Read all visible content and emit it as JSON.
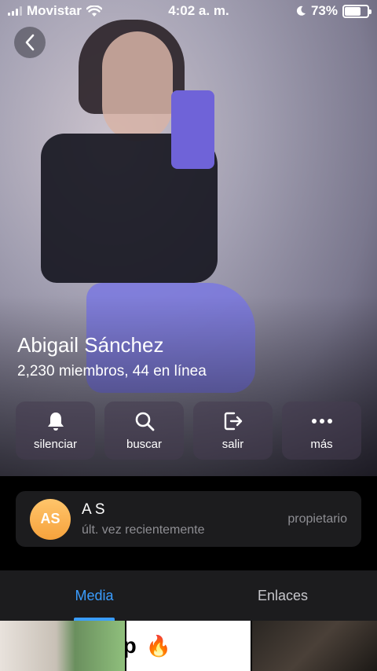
{
  "status_bar": {
    "carrier": "Movistar",
    "time": "4:02 a. m.",
    "battery": "73%",
    "battery_level": 0.73
  },
  "profile": {
    "name": "Abigail Sánchez",
    "subtitle": "2,230 miembros, 44 en línea"
  },
  "actions": [
    {
      "label": "silenciar",
      "icon": "bell-icon"
    },
    {
      "label": "buscar",
      "icon": "search-icon"
    },
    {
      "label": "salir",
      "icon": "leave-icon"
    },
    {
      "label": "más",
      "icon": "more-icon"
    }
  ],
  "owner": {
    "initials": "AS",
    "name": "A S",
    "status": "últ. vez recientemente",
    "role": "propietario"
  },
  "tabs": [
    {
      "label": "Media",
      "active": true
    },
    {
      "label": "Enlaces",
      "active": false
    }
  ],
  "media": {
    "thumb2_text": "p",
    "thumb2_emoji": "🔥"
  },
  "colors": {
    "accent": "#3a9dff",
    "card_bg": "#1c1c1e",
    "avatar": "#f6a23c"
  }
}
